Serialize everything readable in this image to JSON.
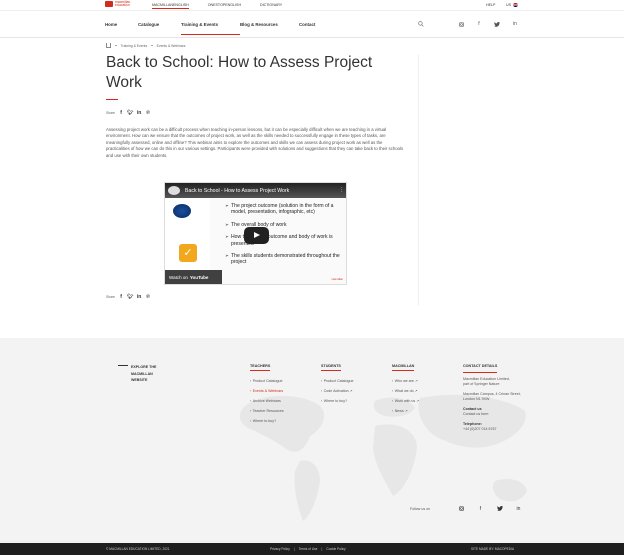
{
  "brand": {
    "name_line1": "macmillan",
    "name_line2": "education",
    "accent": "#d52b1e"
  },
  "topbar": {
    "sites": [
      "MACMILLANENGLISH",
      "ONESTOPENGLISH",
      "DICTIONARY"
    ],
    "help": "HELP",
    "lang": "US"
  },
  "nav": {
    "items": [
      "Home",
      "Catalogue",
      "Training & Events",
      "Blog & Resources",
      "Contact"
    ],
    "active": "Training & Events",
    "icons": [
      "search-icon",
      "instagram-icon",
      "facebook-icon",
      "twitter-icon",
      "linkedin-icon"
    ]
  },
  "breadcrumb": [
    "Training & Events",
    "Events & Webinars"
  ],
  "article": {
    "title": "Back to School: How to Assess Project Work",
    "share_label": "Share",
    "body": "Assessing project work can be a difficult process when teaching in-person lessons, but it can be especially difficult when we are teaching in a virtual environment. How can we ensure that the outcomes of project work, as well as the skills needed to successfully engage in these types of tasks, are meaningfully assessed, online and offline? This webinar aims to explore the outcomes and skills we can assess during project work as well as the practicalities of how we can do this in our various settings. Participants were provided with solutions and suggestions that they can take back to their schools and use with their own students."
  },
  "video": {
    "title": "Back to School - How to Assess Project Work",
    "bullets": [
      "The project outcome (solution in the form of a model, presentation, infographic, etc)",
      "The overall body of work",
      "How the project outcome and body of work is presented",
      "The skills students demonstrated throughout the project"
    ],
    "watch_on": "Watch on",
    "youtube": "YouTube",
    "brand": "macmillan"
  },
  "footer": {
    "explore": "EXPLORE THE MACMILLAN WEBSITE",
    "columns": [
      {
        "title": "TEACHERS",
        "items": [
          "Product Catalogue",
          "Events & Webinars",
          "Archive Webinars",
          "Teacher Resources",
          "Where to buy?"
        ],
        "active_index": 1
      },
      {
        "title": "STUDENTS",
        "items": [
          "Product Catalogue",
          "Code Activation ↗",
          "Where to buy?"
        ],
        "active_index": -1
      },
      {
        "title": "MACMILLAN",
        "items": [
          "Who we are ↗",
          "What we do ↗",
          "Work with us ↗",
          "News ↗"
        ],
        "active_index": -1
      }
    ],
    "contact": {
      "title": "CONTACT DETAILS",
      "company": "Macmillan Education Limited,",
      "part_of": "part of Springer Nature",
      "address": "Macmillan Campus, 4 Crinan Street, London N1 9XW",
      "contact_us_heading": "Contact us",
      "contact_form": "Contact us form",
      "telephone_heading": "Telephone:",
      "telephone": "+44 (0)207 014 6767"
    },
    "follow": "Follow us on",
    "social_icons": [
      "instagram-icon",
      "facebook-icon",
      "twitter-icon",
      "linkedin-icon"
    ]
  },
  "bottombar": {
    "copyright": "© MACMILLAN EDUCATION LIMITED, 2021",
    "links": [
      "Privacy Policy",
      "Terms of Use",
      "Cookie Policy"
    ],
    "made_by": "SITE MADE BY: MACOPEDIA"
  }
}
